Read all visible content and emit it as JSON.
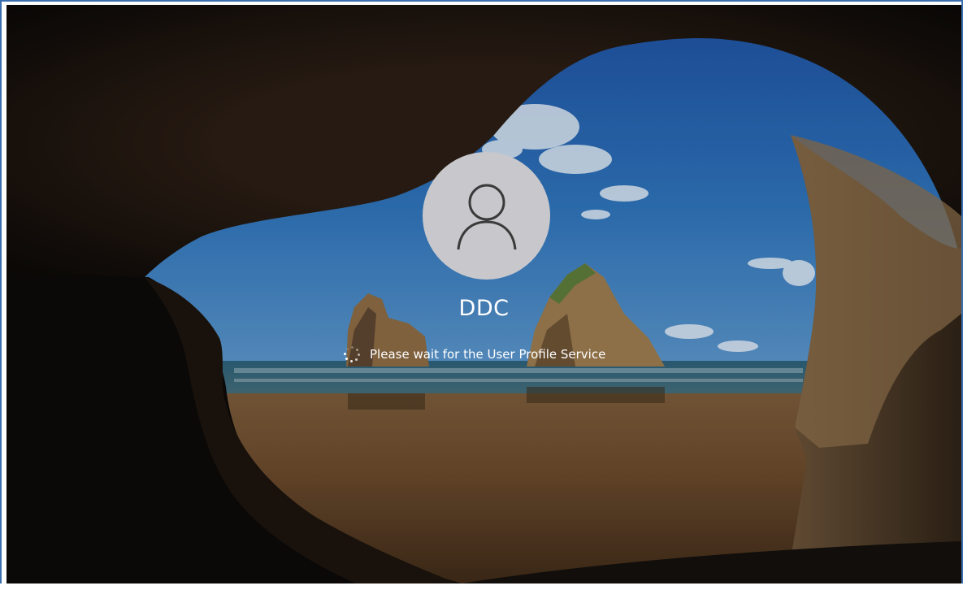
{
  "lock_screen": {
    "username": "DDC",
    "status_message": "Please wait for the User Profile Service",
    "avatar_icon": "user-icon",
    "spinner_icon": "loading-spinner-icon"
  },
  "colors": {
    "avatar_background": "#c8c8cc",
    "text": "#ffffff",
    "frame_border": "#3b6fb0"
  }
}
